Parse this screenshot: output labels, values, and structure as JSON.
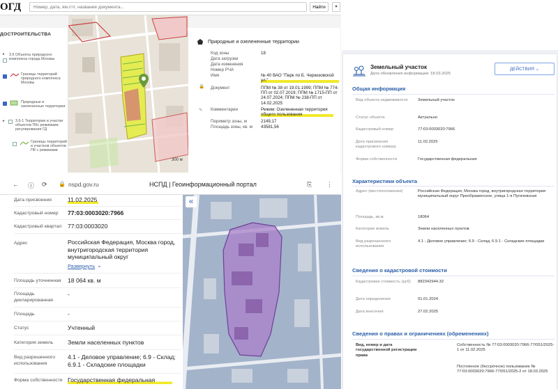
{
  "isogd": {
    "logo": "ОГД",
    "search_placeholder": "Номер, дата, ям.гггг, название документа...",
    "search_button": "Найти",
    "layers_title": "ДОСТРОИТЕЛЬСТВА",
    "layers": [
      {
        "label": "3.6 Объекты природного комплекса города Москвы"
      },
      {
        "label": "Границы территорий природного комплекса Москвы"
      },
      {
        "label": "Природные и озелененные территории"
      },
      {
        "label": "3.6-1 Территории и участки объектов ПКс режимами регулирования ГД"
      },
      {
        "label": "Границы территорий и участков объектов ПК с режимами"
      }
    ],
    "map_scale": "300 м",
    "info": {
      "title": "Природные и озелененные территории",
      "rows": [
        {
          "label": "Код зоны",
          "value": "18"
        },
        {
          "label": "Дата загрузки",
          "value": ""
        },
        {
          "label": "Дата изменения",
          "value": ""
        },
        {
          "label": "Номер РЧА",
          "value": ""
        },
        {
          "label": "Имя",
          "value": "№ 40 ВАО \"Парк по Б. Черкизовской ул.\""
        },
        {
          "label": "Документ",
          "value": "ППМ № 38 от 19.01.1999; ППМ № 774-ПП от 02.07.2019; ППМ № 1715-ПП от 24.07.2024; ППМ № 238-ПП от 14.02.2025"
        },
        {
          "label": "Комментарии",
          "value": "Режим: Озелененная территория общего пользования"
        },
        {
          "label": "Периметр зоны, м",
          "value": "2149,17"
        },
        {
          "label": "Площадь зоны, кв. м",
          "value": "43581,56"
        }
      ]
    }
  },
  "nspd": {
    "url": "nspd.gov.ru",
    "page_title": "НСПД | Геоинформационный портал",
    "expand_link": "Развернуть",
    "rows": [
      {
        "label": "Дата присвоения",
        "value": "11.02.2025"
      },
      {
        "label": "Кадастровый номер",
        "value": "77:03:0003020:7966"
      },
      {
        "label": "Кадастровый квартал",
        "value": "77:03:0003020"
      },
      {
        "label": "Адрес",
        "value": "Российская Федерация, Москва город, внутригородская территория муниципальный округ"
      },
      {
        "label": "Площадь уточненная",
        "value": "18 064 кв. м"
      },
      {
        "label": "Площадь декларированная",
        "value": "-"
      },
      {
        "label": "Площадь",
        "value": "-"
      },
      {
        "label": "Статус",
        "value": "Учтенный"
      },
      {
        "label": "Категория земель",
        "value": "Земли населенных пунктов"
      },
      {
        "label": "Вид разрешенного использования",
        "value": "4.1 - Деловое управление; 6.9 - Склад; 6.9.1 - Складские площадки"
      },
      {
        "label": "Форма собственности",
        "value": "Государственная федеральная"
      }
    ],
    "map_collapse": "«"
  },
  "card": {
    "title": "Земельный участок",
    "date": "Дата обновления информации: 18.03.2025",
    "actions": "ДЕЙСТВИЯ ⌄",
    "sections": {
      "general": {
        "title": "Общая информация",
        "rows": [
          {
            "label": "Вид объекта недвижимости",
            "value": "Земельный участок"
          },
          {
            "label": "Статус объекта",
            "value": "Актуально"
          },
          {
            "label": "Кадастровый номер",
            "value": "77:03:0003020:7966"
          },
          {
            "label": "Дата присвоения кадастрового номера",
            "value": "11.02.2025"
          },
          {
            "label": "Форма собственности",
            "value": "Государственная федеральная"
          }
        ]
      },
      "characteristics": {
        "title": "Характеристики объекта",
        "rows": [
          {
            "label": "Адрес (местоположение)",
            "value": "Российская Федерация, Москва город, внутригородская территория муниципальный округ Преображенское, улица 1-я Пугачевская"
          },
          {
            "label": "Площадь, кв.м",
            "value": "18064"
          },
          {
            "label": "Категория земель",
            "value": "Земли населенных пунктов"
          },
          {
            "label": "Вид разрешенного использования",
            "value": "4.1 - Деловое управление; 6.9 - Склад; 6.9.1 - Складские площадки"
          }
        ]
      },
      "cost": {
        "title": "Сведения о кадастровой стоимости",
        "rows": [
          {
            "label": "Кадастровая стоимость (руб)",
            "value": "882342944.32"
          },
          {
            "label": "Дата определения",
            "value": "01.01.2024"
          },
          {
            "label": "Дата внесения",
            "value": "27.02.2025"
          }
        ]
      },
      "rights": {
        "title": "Сведения о правах и ограничениях (обременениях)",
        "label": "Вид, номер и дата государственной регистрации права",
        "value1": "Собственность № 77:03:0003020:7966-77/051/2025-1 от 11.02.2025",
        "value2": "Постоянное (бессрочное) пользование № 77:03:0003020:7966-77/051/2025-2 от 18.03.2025"
      }
    }
  },
  "colors": {
    "accent_blue": "#2a5ea8",
    "parcel_purple": "#a980c9",
    "highlight_yellow": "#f2e92a"
  }
}
